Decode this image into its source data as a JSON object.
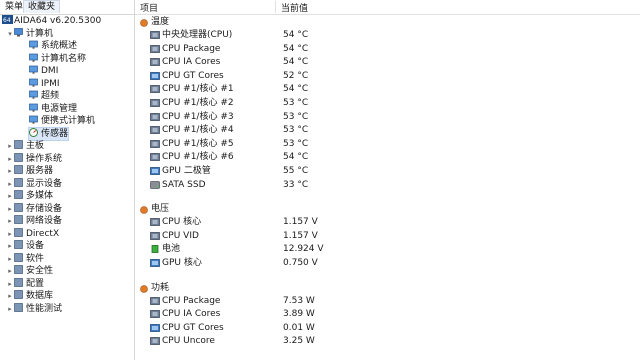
{
  "tabs": [
    "菜单",
    "收藏夹"
  ],
  "tree": {
    "root": "AIDA64 v6.20.5300",
    "computer": "计算机",
    "computer_children": [
      "系统概述",
      "计算机名称",
      "DMI",
      "IPMI",
      "超频",
      "电源管理",
      "便携式计算机",
      "传感器"
    ],
    "categories": [
      "主板",
      "操作系统",
      "服务器",
      "显示设备",
      "多媒体",
      "存储设备",
      "网络设备",
      "DirectX",
      "设备",
      "软件",
      "安全性",
      "配置",
      "数据库",
      "性能测试"
    ]
  },
  "columns": {
    "item": "项目",
    "value": "当前值"
  },
  "sections": [
    {
      "title": "温度",
      "rows": [
        {
          "label": "中央处理器(CPU)",
          "value": "54 °C",
          "icon": "cpu-chip-icon"
        },
        {
          "label": "CPU Package",
          "value": "54 °C",
          "icon": "cpu-chip-icon"
        },
        {
          "label": "CPU IA Cores",
          "value": "54 °C",
          "icon": "cpu-chip-icon"
        },
        {
          "label": "CPU GT Cores",
          "value": "52 °C",
          "icon": "gpu-icon"
        },
        {
          "label": "CPU #1/核心 #1",
          "value": "54 °C",
          "icon": "cpu-chip-icon"
        },
        {
          "label": "CPU #1/核心 #2",
          "value": "53 °C",
          "icon": "cpu-chip-icon"
        },
        {
          "label": "CPU #1/核心 #3",
          "value": "53 °C",
          "icon": "cpu-chip-icon"
        },
        {
          "label": "CPU #1/核心 #4",
          "value": "53 °C",
          "icon": "cpu-chip-icon"
        },
        {
          "label": "CPU #1/核心 #5",
          "value": "53 °C",
          "icon": "cpu-chip-icon"
        },
        {
          "label": "CPU #1/核心 #6",
          "value": "54 °C",
          "icon": "cpu-chip-icon"
        },
        {
          "label": "GPU 二极管",
          "value": "55 °C",
          "icon": "gpu-icon"
        },
        {
          "label": "SATA SSD",
          "value": "33 °C",
          "icon": "disk-icon"
        }
      ]
    },
    {
      "title": "电压",
      "rows": [
        {
          "label": "CPU 核心",
          "value": "1.157 V",
          "icon": "cpu-chip-icon"
        },
        {
          "label": "CPU VID",
          "value": "1.157 V",
          "icon": "cpu-chip-icon"
        },
        {
          "label": "电池",
          "value": "12.924 V",
          "icon": "battery-icon"
        },
        {
          "label": "GPU 核心",
          "value": "0.750 V",
          "icon": "gpu-icon"
        }
      ]
    },
    {
      "title": "功耗",
      "rows": [
        {
          "label": "CPU Package",
          "value": "7.53 W",
          "icon": "cpu-chip-icon"
        },
        {
          "label": "CPU IA Cores",
          "value": "3.89 W",
          "icon": "cpu-chip-icon"
        },
        {
          "label": "CPU GT Cores",
          "value": "0.01 W",
          "icon": "gpu-icon"
        },
        {
          "label": "CPU Uncore",
          "value": "3.25 W",
          "icon": "cpu-chip-icon"
        }
      ]
    }
  ],
  "colors": {
    "selection": "#d8e6f7",
    "accent": "#2f6fbf"
  }
}
